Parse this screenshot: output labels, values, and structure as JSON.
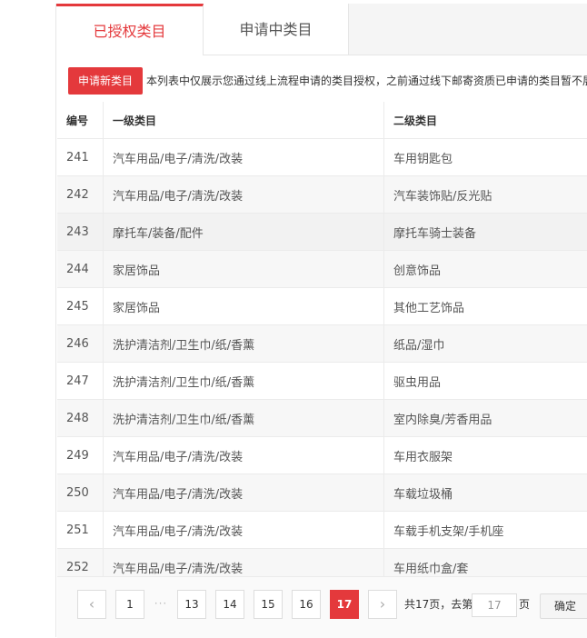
{
  "tabs": [
    {
      "label": "已授权类目",
      "active": true
    },
    {
      "label": "申请中类目",
      "active": false
    }
  ],
  "apply_button": "申请新类目",
  "notice": "本列表中仅展示您通过线上流程申请的类目授权，之前通过线下邮寄资质已申请的类目暂不展",
  "table": {
    "headers": [
      "编号",
      "一级类目",
      "二级类目"
    ],
    "rows": [
      [
        "241",
        "汽车用品/电子/清洗/改装",
        "车用钥匙包"
      ],
      [
        "242",
        "汽车用品/电子/清洗/改装",
        "汽车装饰贴/反光贴"
      ],
      [
        "243",
        "摩托车/装备/配件",
        "摩托车骑士装备"
      ],
      [
        "244",
        "家居饰品",
        "创意饰品"
      ],
      [
        "245",
        "家居饰品",
        "其他工艺饰品"
      ],
      [
        "246",
        "洗护清洁剂/卫生巾/纸/香薰",
        "纸品/湿巾"
      ],
      [
        "247",
        "洗护清洁剂/卫生巾/纸/香薰",
        "驱虫用品"
      ],
      [
        "248",
        "洗护清洁剂/卫生巾/纸/香薰",
        "室内除臭/芳香用品"
      ],
      [
        "249",
        "汽车用品/电子/清洗/改装",
        "车用衣服架"
      ],
      [
        "250",
        "汽车用品/电子/清洗/改装",
        "车载垃圾桶"
      ],
      [
        "251",
        "汽车用品/电子/清洗/改装",
        "车载手机支架/手机座"
      ],
      [
        "252",
        "汽车用品/电子/清洗/改装",
        "车用纸巾盒/套"
      ]
    ]
  },
  "pagination": {
    "prev": "‹",
    "next": "›",
    "first": "1",
    "ellipsis": "···",
    "pages": [
      "13",
      "14",
      "15",
      "16",
      "17"
    ],
    "current": "17",
    "total_text": "共17页，去第",
    "goto_value": "17",
    "page_unit": "页",
    "confirm": "确定"
  },
  "colors": {
    "accent": "#e4393c"
  }
}
